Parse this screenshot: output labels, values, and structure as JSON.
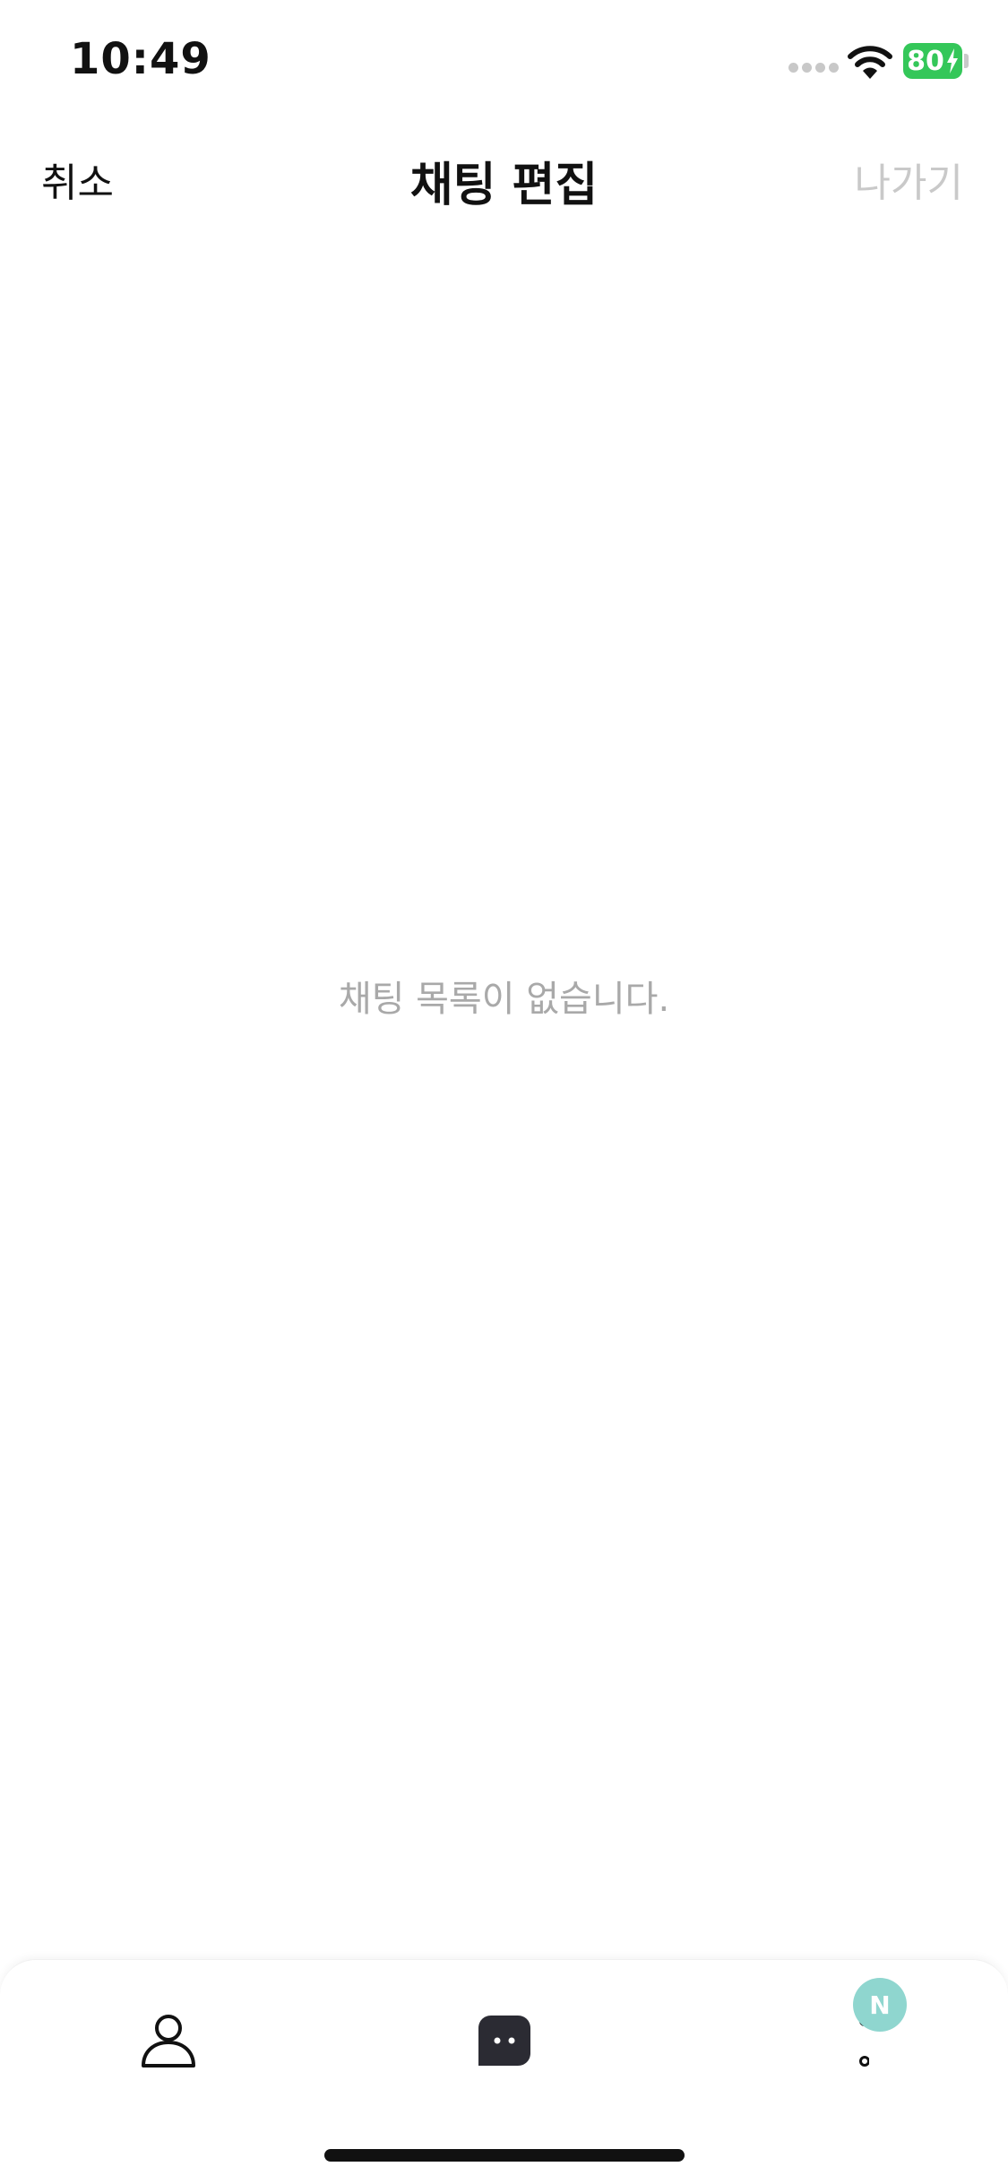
{
  "status_bar": {
    "time": "10:49",
    "battery_level": "80",
    "icons": [
      "cellular-signal-icon",
      "wifi-icon",
      "battery-charging-icon"
    ]
  },
  "nav_bar": {
    "cancel_label": "취소",
    "title": "채팅 편집",
    "leave_label": "나가기"
  },
  "empty_state": {
    "message": "채팅 목록이 없습니다."
  },
  "tab_bar": {
    "tabs": [
      {
        "icon": "person-icon"
      },
      {
        "icon": "chat-bubble-icon",
        "selected": true
      },
      {
        "icon": "more-dots-icon"
      }
    ],
    "badge_label": "N"
  },
  "colors": {
    "battery": "#34c759",
    "disabled_text": "#c9c9c9",
    "placeholder_text": "#a9a9a9",
    "badge": "#8fd6cf",
    "tab_icon": "#2b2b33"
  }
}
